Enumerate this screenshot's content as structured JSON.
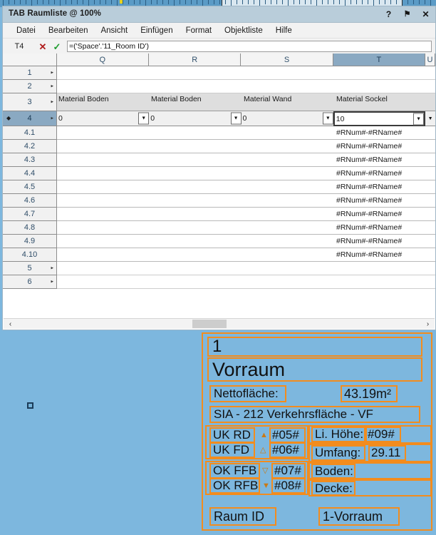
{
  "window": {
    "title": "TAB Raumliste @ 100%",
    "controls": [
      {
        "name": "help-button",
        "glyph": "?"
      },
      {
        "name": "pin-button",
        "glyph": "⚑"
      },
      {
        "name": "close-button",
        "glyph": "✕"
      }
    ]
  },
  "menu": {
    "items": [
      "Datei",
      "Bearbeiten",
      "Ansicht",
      "Einfügen",
      "Format",
      "Objektliste",
      "Hilfe"
    ]
  },
  "formula_bar": {
    "cell_ref": "T4",
    "cancel_glyph": "✕",
    "accept_glyph": "✓",
    "value": "=('Space'.'11_Room ID')"
  },
  "grid": {
    "columns": [
      "Q",
      "R",
      "S",
      "T",
      "U"
    ],
    "selected_column": "T",
    "header_labels": [
      "Material Boden",
      "Material Boden",
      "Material Wand",
      "Material Sockel"
    ],
    "selected_row": "4",
    "row4_values": [
      "0",
      "0",
      "0",
      "10"
    ],
    "rows": [
      {
        "label": "1",
        "expandable": true,
        "type": "empty"
      },
      {
        "label": "2",
        "expandable": true,
        "type": "empty"
      },
      {
        "label": "3",
        "expandable": true,
        "type": "header"
      },
      {
        "label": "4",
        "expandable": true,
        "type": "selected"
      },
      {
        "label": "4.1",
        "expandable": false,
        "type": "data",
        "value": "#RNum#-#RName#"
      },
      {
        "label": "4.2",
        "expandable": false,
        "type": "data",
        "value": "#RNum#-#RName#"
      },
      {
        "label": "4.3",
        "expandable": false,
        "type": "data",
        "value": "#RNum#-#RName#"
      },
      {
        "label": "4.4",
        "expandable": false,
        "type": "data",
        "value": "#RNum#-#RName#"
      },
      {
        "label": "4.5",
        "expandable": false,
        "type": "data",
        "value": "#RNum#-#RName#"
      },
      {
        "label": "4.6",
        "expandable": false,
        "type": "data",
        "value": "#RNum#-#RName#"
      },
      {
        "label": "4.7",
        "expandable": false,
        "type": "data",
        "value": "#RNum#-#RName#"
      },
      {
        "label": "4.8",
        "expandable": false,
        "type": "data",
        "value": "#RNum#-#RName#"
      },
      {
        "label": "4.9",
        "expandable": false,
        "type": "data",
        "value": "#RNum#-#RName#"
      },
      {
        "label": "4.10",
        "expandable": false,
        "type": "data",
        "value": "#RNum#-#RName#"
      },
      {
        "label": "5",
        "expandable": true,
        "type": "empty"
      },
      {
        "label": "6",
        "expandable": true,
        "type": "empty"
      }
    ],
    "dropdown_glyph": "▼",
    "expand_glyph": "▸",
    "selected_marker": "◆"
  },
  "scrollbar": {
    "left_glyph": "‹",
    "right_glyph": "›"
  },
  "room_card": {
    "number": "1",
    "name": "Vorraum",
    "area_label": "Nettofläche:",
    "area_value": "43.19m²",
    "classification": "SIA - 212 Verkehrsfläche - VF",
    "levels": [
      {
        "label": "UK RD",
        "marker": "▲",
        "value": "#05#"
      },
      {
        "label": "UK FD",
        "marker": "△",
        "value": "#06#"
      },
      {
        "label": "OK FFB",
        "marker": "▽",
        "value": "#07#"
      },
      {
        "label": "OK RFB",
        "marker": "▼",
        "value": "#08#"
      }
    ],
    "height_label": "Li. Höhe:",
    "height_value": "#09#",
    "perimeter_label": "Umfang:",
    "perimeter_value": "29.11",
    "floor_label": "Boden:",
    "ceiling_label": "Decke:",
    "room_id_label": "Raum ID",
    "room_id_value": "1-Vorraum"
  },
  "colors": {
    "canvas": "#7db7de",
    "card_border": "#f28c1e",
    "selection": "#8aa9c2"
  }
}
